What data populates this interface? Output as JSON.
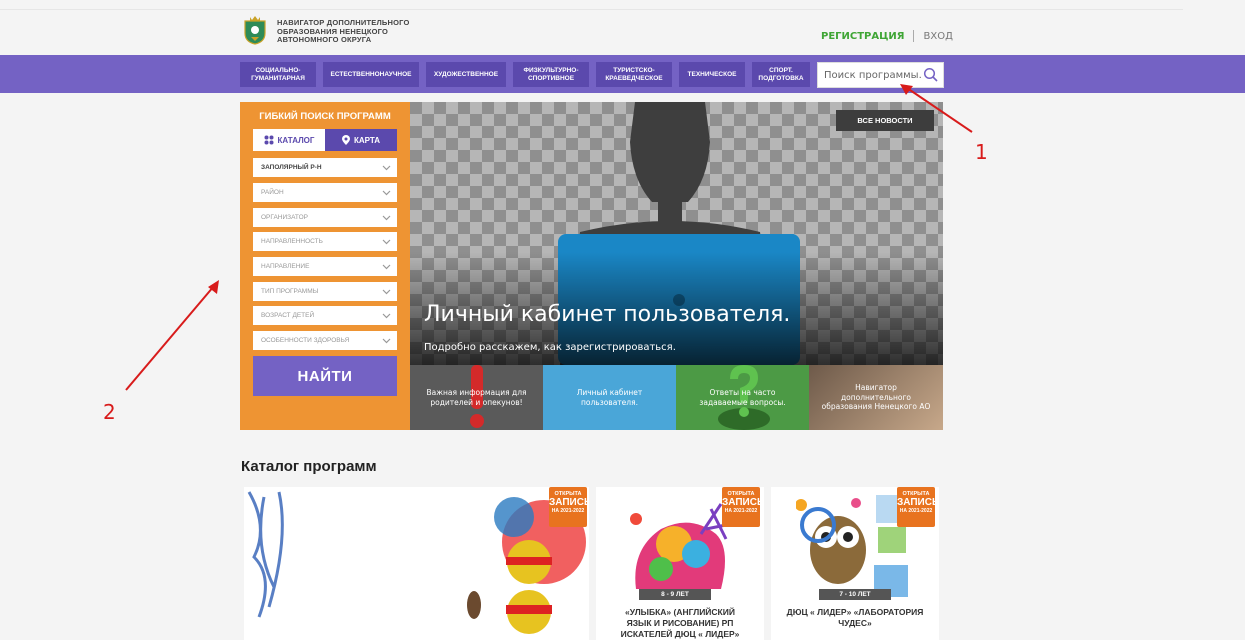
{
  "header": {
    "logo_line1": "НАВИГАТОР ДОПОЛНИТЕЛЬНОГО",
    "logo_line2": "ОБРАЗОВАНИЯ НЕНЕЦКОГО",
    "logo_line3": "АВТОНОМНОГО ОКРУГА",
    "register": "РЕГИСТРАЦИЯ",
    "login": "ВХОД"
  },
  "nav": {
    "items": [
      {
        "line1": "СОЦИАЛЬНО-",
        "line2": "ГУМАНИТАРНАЯ"
      },
      {
        "line1": "ЕСТЕСТВЕННОНАУЧНОЕ",
        "line2": ""
      },
      {
        "line1": "ХУДОЖЕСТВЕННОЕ",
        "line2": ""
      },
      {
        "line1": "ФИЗКУЛЬТУРНО-",
        "line2": "СПОРТИВНОЕ"
      },
      {
        "line1": "ТУРИСТСКО-",
        "line2": "КРАЕВЕДЧЕСКОЕ"
      },
      {
        "line1": "ТЕХНИЧЕСКОЕ",
        "line2": ""
      },
      {
        "line1": "СПОРТ.",
        "line2": "ПОДГОТОВКА"
      }
    ],
    "search_placeholder": "Поиск программы..."
  },
  "filter": {
    "title": "ГИБКИЙ ПОИСК ПРОГРАММ",
    "tab_catalog": "КАТАЛОГ",
    "tab_map": "КАРТА",
    "selects": [
      "ЗАПОЛЯРНЫЙ Р-Н",
      "РАЙОН",
      "ОРГАНИЗАТОР",
      "НАПРАВЛЕННОСТЬ",
      "НАПРАВЛЕНИЕ",
      "ТИП ПРОГРАММЫ",
      "ВОЗРАСТ ДЕТЕЙ",
      "ОСОБЕННОСТИ ЗДОРОВЬЯ"
    ],
    "find_button": "НАЙТИ"
  },
  "banner": {
    "all_news": "ВСЕ НОВОСТИ",
    "title": "Личный кабинет пользователя.",
    "subtitle": "Подробно расскажем, как зарегистрироваться.",
    "thumbs": [
      "Важная информация для родителей и опекунов!",
      "Личный кабинет пользователя.",
      "Ответы на часто задаваемые вопросы.",
      "Навигатор дополнительного образования Ненецкого АО"
    ]
  },
  "catalog": {
    "title": "Каталог программ",
    "badge_top": "ОТКРЫТА",
    "badge_mid": "ЗАПИСЬ",
    "badge_bottom": "НА 2021-2022",
    "cards": [
      {
        "age": "",
        "title": ""
      },
      {
        "age": "8 - 9 ЛЕТ",
        "title_l1": "«УЛЫБКА» (АНГЛИЙСКИЙ",
        "title_l2": "ЯЗЫК И РИСОВАНИЕ) РП",
        "title_l3": "ИСКАТЕЛЕЙ ДЮЦ « ЛИДЕР»"
      },
      {
        "age": "7 - 10 ЛЕТ",
        "title_l1": "ДЮЦ « ЛИДЕР» «ЛАБОРАТОРИЯ",
        "title_l2": "ЧУДЕС»",
        "title_l3": ""
      }
    ]
  },
  "annotations": {
    "label1": "1",
    "label2": "2",
    "color": "#d81b1b"
  },
  "colors": {
    "nav_bg": "#7462c4",
    "nav_btn": "#5b49ad",
    "filter_bg": "#ee9433",
    "register": "#3fa535",
    "badge": "#e8731f"
  }
}
